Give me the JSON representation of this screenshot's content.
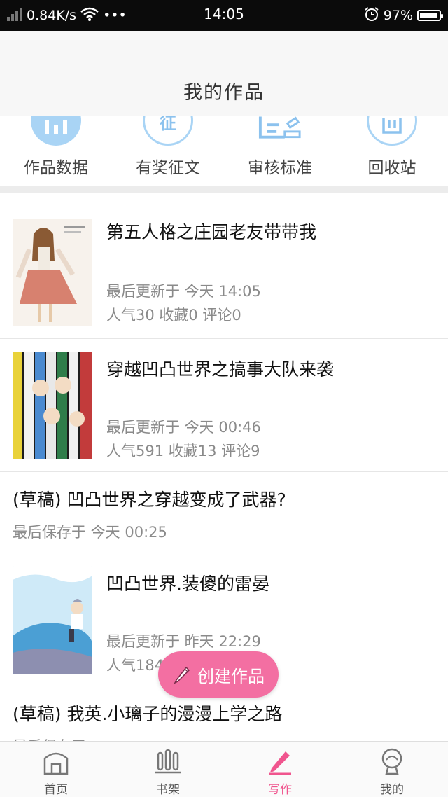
{
  "status_bar": {
    "network_speed": "0.84K/s",
    "more": "•••",
    "time": "14:05",
    "battery_percent": "97%",
    "battery_level": 0.97
  },
  "header": {
    "title": "我的作品"
  },
  "quick_actions": [
    {
      "label": "作品数据",
      "icon": "bar-chart-icon"
    },
    {
      "label": "有奖征文",
      "icon": "contest-icon",
      "glyph": "征"
    },
    {
      "label": "审核标准",
      "icon": "review-icon"
    },
    {
      "label": "回收站",
      "icon": "recycle-bin-icon"
    }
  ],
  "works": [
    {
      "title": "第五人格之庄园老友带带我",
      "updated": "最后更新于 今天 14:05",
      "stats": "人气30 收藏0 评论0",
      "cover_colors": [
        "#f3ece4",
        "#c9675a",
        "#7a5a3a"
      ]
    },
    {
      "title": "穿越凹凸世界之搞事大队来袭",
      "updated": "最后更新于 今天 00:46",
      "stats": "人气591 收藏13 评论9",
      "cover_colors": [
        "#2b2b2b",
        "#e9d23a",
        "#5a8fcf",
        "#e8e8e8"
      ]
    },
    {
      "draft": true,
      "title": "(草稿) 凹凸世界之穿越变成了武器?",
      "saved": "最后保存于 今天 00:25"
    },
    {
      "title": "凹凸世界.装傻的雷晏",
      "updated": "最后更新于 昨天 22:29",
      "stats": "人气184",
      "cover_colors": [
        "#bfe3f7",
        "#4b9fd4",
        "#8d8fb0"
      ]
    },
    {
      "draft": true,
      "title": "(草稿) 我英.小璃子的漫漫上学之路",
      "saved": "最后保存于 …"
    }
  ],
  "create_button": {
    "label": "创建作品"
  },
  "tabbar": [
    {
      "label": "首页",
      "icon": "home-icon",
      "active": false
    },
    {
      "label": "书架",
      "icon": "bookshelf-icon",
      "active": false
    },
    {
      "label": "写作",
      "icon": "pen-icon",
      "active": true
    },
    {
      "label": "我的",
      "icon": "profile-icon",
      "active": false
    }
  ],
  "colors": {
    "accent_pink": "#f36fa2",
    "icon_blue": "#a9d4f5"
  }
}
